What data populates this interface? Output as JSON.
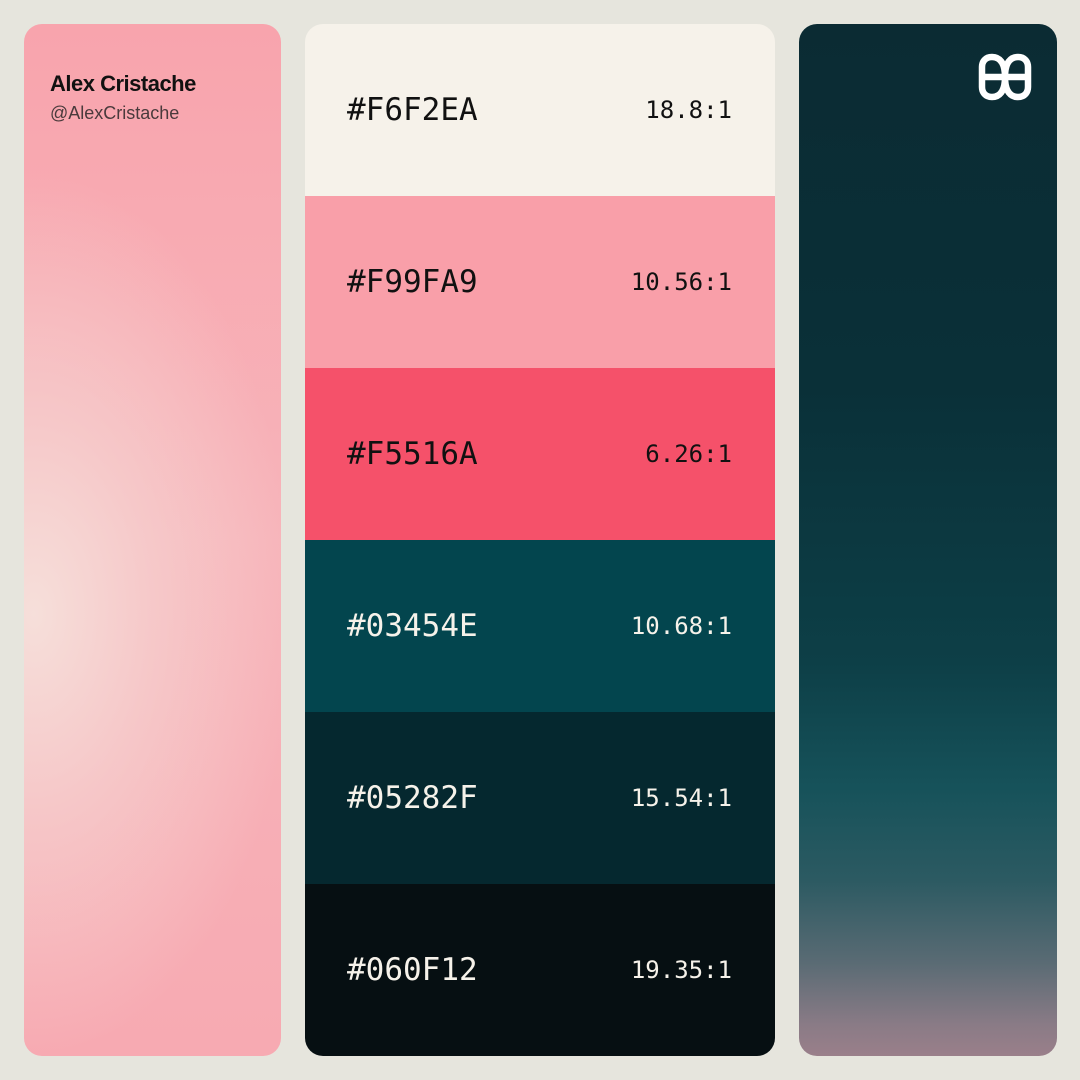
{
  "author": {
    "name": "Alex Cristache",
    "handle": "@AlexCristache"
  },
  "logo_icon": "double-loop-logo-icon",
  "swatches": [
    {
      "hex": "#F6F2EA",
      "ratio": "18.8:1",
      "bg": "#f6f2ea",
      "text_color": "#111111"
    },
    {
      "hex": "#F99FA9",
      "ratio": "10.56:1",
      "bg": "#f99fa9",
      "text_color": "#111111"
    },
    {
      "hex": "#F5516A",
      "ratio": "6.26:1",
      "bg": "#f5516a",
      "text_color": "#111111"
    },
    {
      "hex": "#03454E",
      "ratio": "10.68:1",
      "bg": "#03454e",
      "text_color": "#f6f2ea"
    },
    {
      "hex": "#05282F",
      "ratio": "15.54:1",
      "bg": "#05282f",
      "text_color": "#f6f2ea"
    },
    {
      "hex": "#060F12",
      "ratio": "19.35:1",
      "bg": "#060f12",
      "text_color": "#f6f2ea"
    }
  ]
}
